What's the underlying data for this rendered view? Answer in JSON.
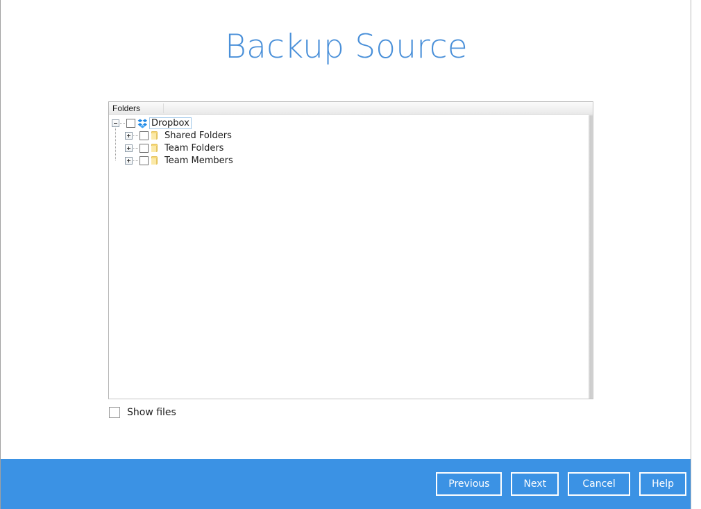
{
  "window": {
    "title": "Backup Source"
  },
  "tree_panel": {
    "header": {
      "column_label": "Folders"
    },
    "root": {
      "label": "Dropbox",
      "icon": "dropbox-icon",
      "expander": "minus",
      "checked": false,
      "focused": true
    },
    "children": [
      {
        "label": "Shared Folders",
        "icon": "folder-icon",
        "expander": "plus",
        "checked": false
      },
      {
        "label": "Team Folders",
        "icon": "folder-icon",
        "expander": "plus",
        "checked": false
      },
      {
        "label": "Team Members",
        "icon": "folder-icon",
        "expander": "plus",
        "checked": false
      }
    ]
  },
  "options": {
    "show_files_label": "Show files",
    "show_files_checked": false
  },
  "footer": {
    "buttons": [
      {
        "label": "Previous"
      },
      {
        "label": "Next"
      },
      {
        "label": "Cancel"
      },
      {
        "label": "Help"
      }
    ]
  },
  "colors": {
    "title_blue": "#4a90d9",
    "footer_blue": "#3b92e4",
    "folder_yellow": "#f7d979",
    "dropbox_blue": "#1e88e5",
    "focus_outline": "#9fc6e8"
  }
}
